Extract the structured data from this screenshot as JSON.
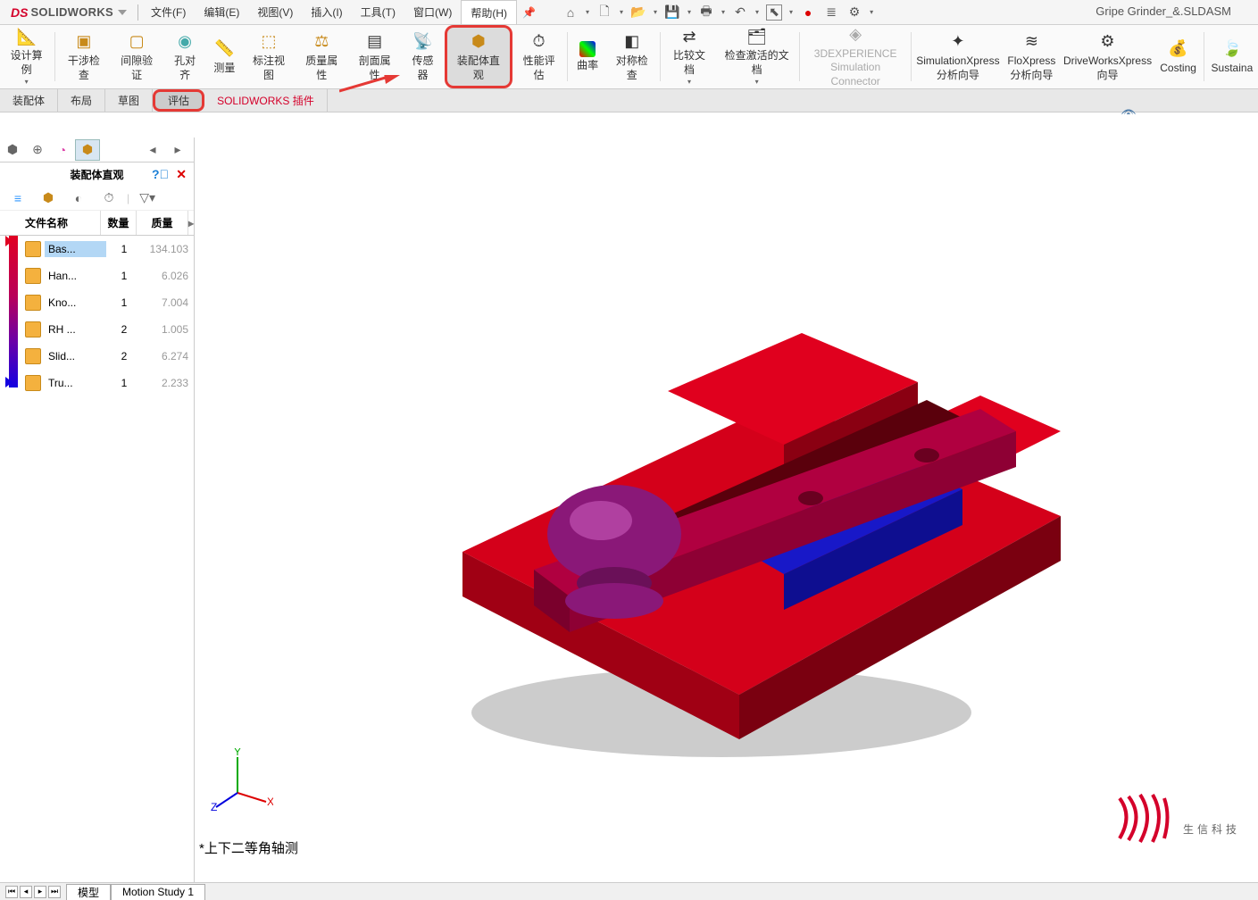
{
  "app": {
    "logo_ds": "DS",
    "logo_sw": "SOLIDWORKS",
    "title": "Gripe Grinder_&.SLDASM"
  },
  "menu": {
    "file": "文件(F)",
    "edit": "编辑(E)",
    "view": "视图(V)",
    "insert": "插入(I)",
    "tools": "工具(T)",
    "window": "窗口(W)",
    "help": "帮助(H)"
  },
  "ribbon": {
    "design_study": "设计算例",
    "interference": "干涉检查",
    "clearance": "间隙验证",
    "hole_align": "孔对齐",
    "measure": "测量",
    "dim_view": "标注视图",
    "mass_props": "质量属性",
    "section_props": "剖面属性",
    "sensors": "传感器",
    "asm_vis": "装配体直观",
    "perf_eval": "性能评估",
    "curvature": "曲率",
    "symmetry": "对称检查",
    "compare": "比较文档",
    "activated": "检查激活的文档",
    "threedx": "3DEXPERIENCE",
    "threedx2": "Simulation Connector",
    "simx": "SimulationXpress",
    "simx2": "分析向导",
    "flox": "FloXpress",
    "flox2": "分析向导",
    "dwx": "DriveWorksXpress",
    "dwx2": "向导",
    "costing": "Costing",
    "sustain": "Sustaina"
  },
  "tabs": {
    "assembly": "装配体",
    "layout": "布局",
    "sketch": "草图",
    "evaluate": "评估",
    "addins": "SOLIDWORKS 插件"
  },
  "panel": {
    "title": "装配体直观",
    "cols": {
      "name": "文件名称",
      "qty": "数量",
      "mass": "质量"
    },
    "rows": [
      {
        "name": "Bas...",
        "qty": "1",
        "mass": "134.103"
      },
      {
        "name": "Han...",
        "qty": "1",
        "mass": "6.026"
      },
      {
        "name": "Kno...",
        "qty": "1",
        "mass": "7.004"
      },
      {
        "name": "RH ...",
        "qty": "2",
        "mass": "1.005"
      },
      {
        "name": "Slid...",
        "qty": "2",
        "mass": "6.274"
      },
      {
        "name": "Tru...",
        "qty": "1",
        "mass": "2.233"
      }
    ]
  },
  "view": {
    "label": "*上下二等角轴测"
  },
  "watermark": {
    "text1": "生",
    "text2": "信",
    "text3": "科",
    "text4": "技"
  },
  "bottom": {
    "model": "模型",
    "motion": "Motion Study 1"
  }
}
